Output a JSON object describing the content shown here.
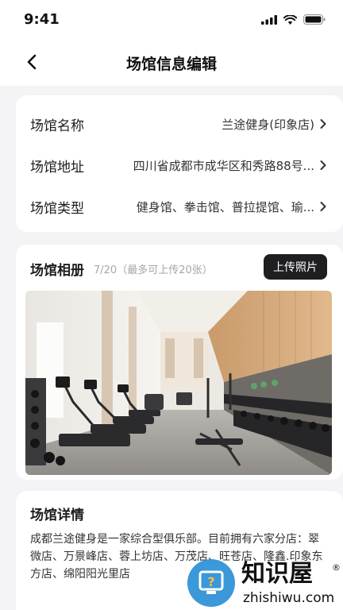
{
  "status_bar": {
    "time": "9:41"
  },
  "nav": {
    "title": "场馆信息编辑"
  },
  "info": {
    "rows": [
      {
        "label": "场馆名称",
        "value": "兰途健身(印象店)"
      },
      {
        "label": "场馆地址",
        "value": "四川省成都市成华区和秀路88号..."
      },
      {
        "label": "场馆类型",
        "value": "健身馆、拳击馆、普拉提馆、瑜..."
      }
    ]
  },
  "album": {
    "title": "场馆相册",
    "count": "7/20（最多可上传20张）",
    "upload_label": "上传照片"
  },
  "detail": {
    "title": "场馆详情",
    "text": "成都兰途健身是一家综合型俱乐部。目前拥有六家分店：翠微店、万景峰店、蓉上坊店、万茂店、旺苍店、隆鑫.印象东方店、绵阳阳光里店"
  },
  "watermark": {
    "brand": "知识屋",
    "domain": "zhishiwu.com"
  },
  "colors": {
    "primary_dark": "#1f1f22",
    "background": "#f4f4f6",
    "muted": "#a6a6ad"
  }
}
